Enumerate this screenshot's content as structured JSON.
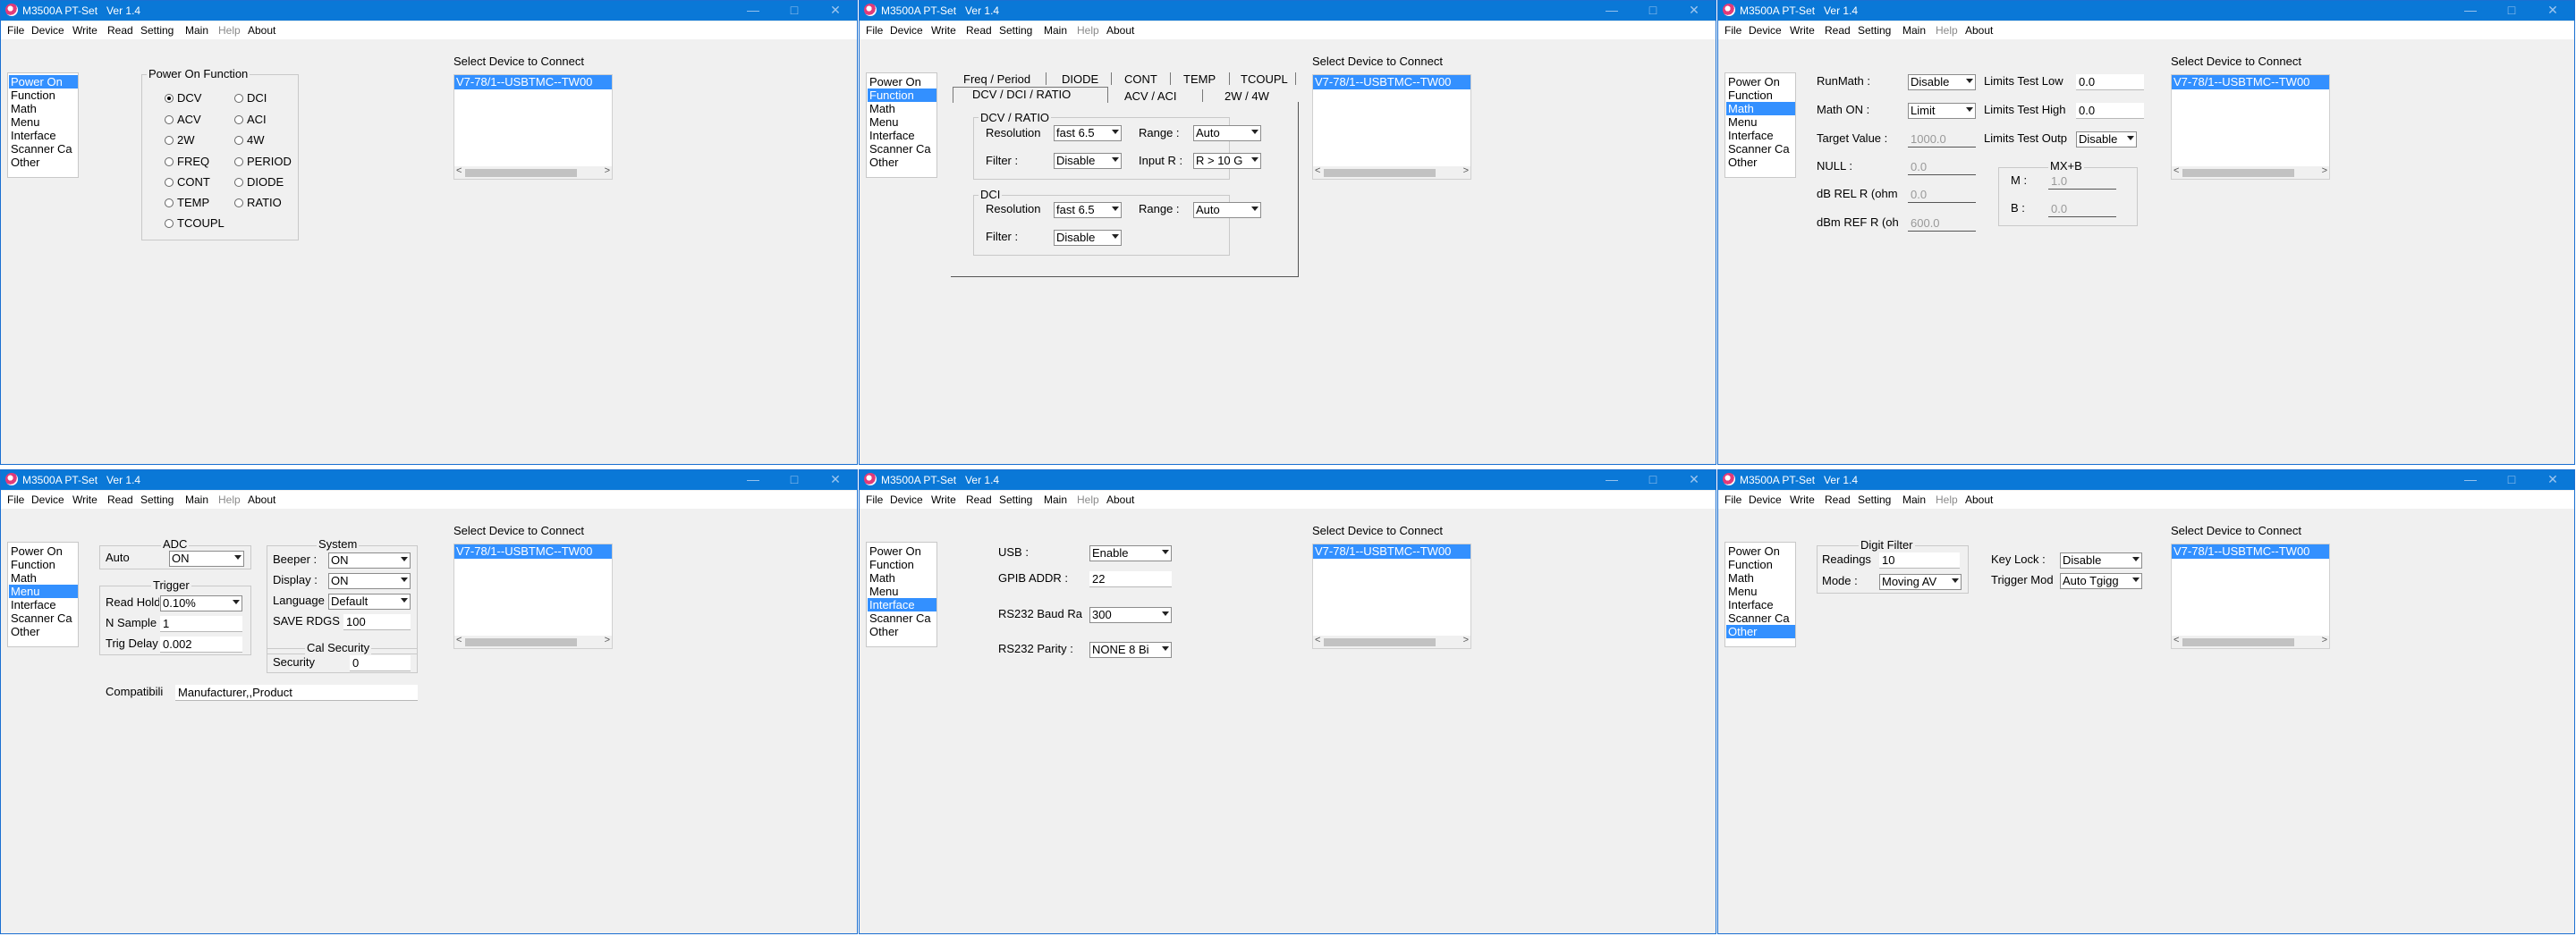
{
  "app_title": "M3500A PT-Set   Ver 1.4",
  "menu": [
    "File",
    "Device",
    "Write",
    "Read",
    "Setting",
    "Main",
    "Help",
    "About"
  ],
  "nav_items": [
    "Power On",
    "Function",
    "Math",
    "Menu",
    "Interface",
    "Scanner Ca",
    "Other"
  ],
  "device_panel": {
    "heading": "Select Device to Connect",
    "device_item": "V7-78/1--USBTMC--TW00",
    "scroll_left": "<",
    "scroll_right": ">"
  },
  "power_on": {
    "group_title": "Power On Function",
    "radios": [
      "DCV",
      "ACV",
      "2W",
      "FREQ",
      "CONT",
      "TEMP",
      "TCOUPL",
      "DCI",
      "ACI",
      "4W",
      "PERIOD",
      "DIODE",
      "RATIO"
    ],
    "selected": "DCV"
  },
  "function": {
    "tabs_row1": [
      "Freq / Period",
      "DIODE",
      "CONT",
      "TEMP",
      "TCOUPL"
    ],
    "tabs_row2": [
      "DCV / DCI / RATIO",
      "ACV / ACI",
      "2W / 4W"
    ],
    "dcv_group": "DCV / RATIO",
    "dci_group": "DCI",
    "resolution_label": "Resolution",
    "range_label": "Range :",
    "filter_label": "Filter :",
    "input_r_label": "Input R :",
    "dcv_resolution": "fast 6.5",
    "dcv_range": "Auto",
    "dcv_filter": "Disable",
    "dcv_input_r": "R > 10 G",
    "dci_resolution": "fast 6.5",
    "dci_range": "Auto",
    "dci_filter": "Disable"
  },
  "math": {
    "runmath_label": "RunMath :",
    "runmath_value": "Disable",
    "mathon_label": "Math ON :",
    "mathon_value": "Limit",
    "target_label": "Target Value :",
    "target_value": "1000.0",
    "null_label": "NULL :",
    "null_value": "0.0",
    "dbrel_label": "dB REL R (ohm",
    "dbrel_value": "0.0",
    "dbmref_label": "dBm REF R (oh",
    "dbmref_value": "600.0",
    "lim_low_label": "Limits Test Low",
    "lim_low_value": "0.0",
    "lim_high_label": "Limits Test High",
    "lim_high_value": "0.0",
    "lim_out_label": "Limits Test Outp",
    "lim_out_value": "Disable",
    "mxb_title": "MX+B",
    "m_label": "M :",
    "m_value": "1.0",
    "b_label": "B :",
    "b_value": "0.0"
  },
  "menu_page": {
    "adc_title": "ADC",
    "adc_label": "Auto",
    "adc_value": "ON",
    "trigger_title": "Trigger",
    "read_hold_label": "Read Hold",
    "read_hold_value": "0.10%",
    "n_sample_label": "N Sample",
    "n_sample_value": "1",
    "trig_delay_label": "Trig Delay",
    "trig_delay_value": "0.002",
    "system_title": "System",
    "beeper_label": "Beeper :",
    "beeper_value": "ON",
    "display_label": "Display :",
    "display_value": "ON",
    "language_label": "Language",
    "language_value": "Default",
    "save_rdgs_label": "SAVE RDGS",
    "save_rdgs_value": "100",
    "cal_title": "Cal Security",
    "security_label": "Security",
    "security_value": "0",
    "compat_label": "Compatibili",
    "compat_value": "Manufacturer,,Product"
  },
  "interface": {
    "usb_label": "USB :",
    "usb_value": "Enable",
    "gpib_label": "GPIB ADDR :",
    "gpib_value": "22",
    "baud_label": "RS232 Baud Ra",
    "baud_value": "300",
    "parity_label": "RS232 Parity :",
    "parity_value": "NONE 8 Bi"
  },
  "other": {
    "digit_title": "Digit Filter",
    "readings_label": "Readings",
    "readings_value": "10",
    "mode_label": "Mode :",
    "mode_value": "Moving AV",
    "keylock_label": "Key Lock :",
    "keylock_value": "Disable",
    "trigmode_label": "Trigger Mod",
    "trigmode_value": "Auto Tgigg"
  }
}
